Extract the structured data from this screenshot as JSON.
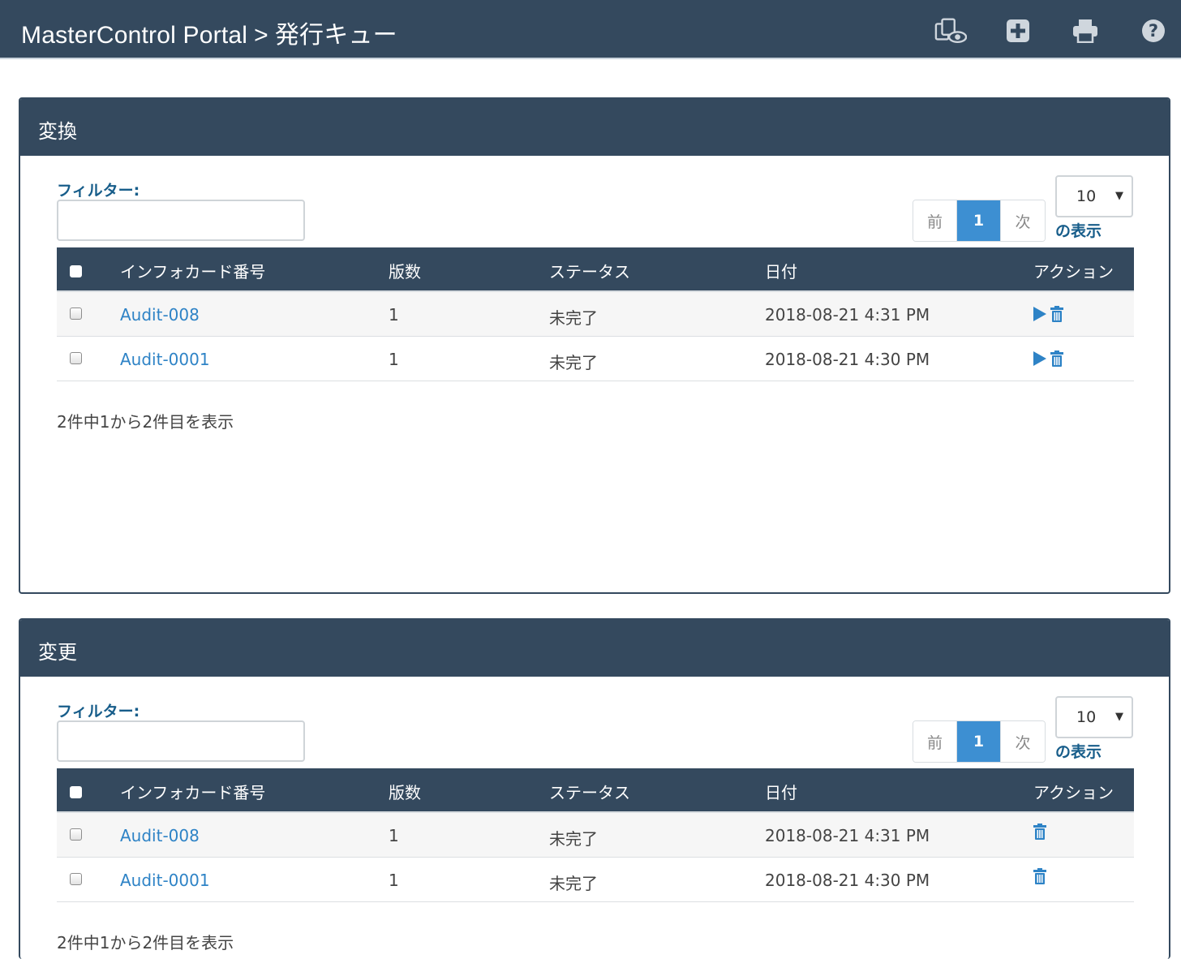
{
  "header": {
    "app": "MasterControl Portal",
    "separator": ">",
    "current": "発行キュー",
    "icons": [
      "preview-icon",
      "plus-square-icon",
      "print-icon",
      "help-icon"
    ]
  },
  "colors": {
    "navy": "#34495e",
    "accent": "#3d8fd2",
    "link": "#2e83c6",
    "label": "#175d8a"
  },
  "panels": [
    {
      "title": "変換",
      "filter_label": "フィルター:",
      "filter_value": "",
      "pager": {
        "prev": "前",
        "page": "1",
        "next": "次"
      },
      "page_length": "10",
      "page_length_label": "の表示",
      "columns": [
        "インフォカード番号",
        "版数",
        "ステータス",
        "日付",
        "アクション"
      ],
      "rows": [
        {
          "id": "Audit-008",
          "version": "1",
          "status": "未完了",
          "date": "2018-08-21 4:31 PM"
        },
        {
          "id": "Audit-0001",
          "version": "1",
          "status": "未完了",
          "date": "2018-08-21 4:30 PM"
        }
      ],
      "actions": [
        "play-icon",
        "trash-icon"
      ],
      "info": "2件中1から2件目を表示"
    },
    {
      "title": "変更",
      "filter_label": "フィルター:",
      "filter_value": "",
      "pager": {
        "prev": "前",
        "page": "1",
        "next": "次"
      },
      "page_length": "10",
      "page_length_label": "の表示",
      "columns": [
        "インフォカード番号",
        "版数",
        "ステータス",
        "日付",
        "アクション"
      ],
      "rows": [
        {
          "id": "Audit-008",
          "version": "1",
          "status": "未完了",
          "date": "2018-08-21 4:31 PM"
        },
        {
          "id": "Audit-0001",
          "version": "1",
          "status": "未完了",
          "date": "2018-08-21 4:30 PM"
        }
      ],
      "actions": [
        "trash-icon"
      ],
      "info": "2件中1から2件目を表示"
    }
  ]
}
